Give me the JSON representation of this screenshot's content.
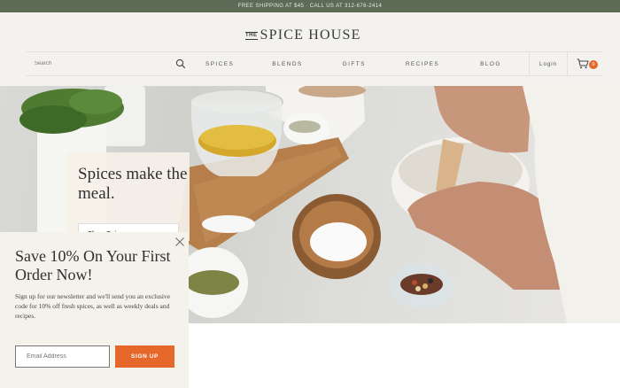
{
  "promo_bar": {
    "text": "FREE SHIPPING AT $45 · CALL US AT 312-676-2414"
  },
  "header": {
    "logo_the": "THE",
    "logo_main": "SPICE HOUSE",
    "search": {
      "placeholder": "Search"
    },
    "nav": [
      {
        "label": "SPICES"
      },
      {
        "label": "BLENDS"
      },
      {
        "label": "GIFTS"
      },
      {
        "label": "RECIPES"
      },
      {
        "label": "BLOG"
      }
    ],
    "login_label": "Login",
    "cart_count": "0"
  },
  "hero": {
    "title": "Spices make the meal.",
    "button_label": "Shop Spices"
  },
  "popup": {
    "title": "Save 10% On Your First Order Now!",
    "text": "Sign up for our newsletter and we'll send you an exclusive code for 10% off fresh spices, as well as weekly deals and recipes.",
    "email_placeholder": "Email Address",
    "signup_label": "SIGN UP"
  },
  "colors": {
    "promo_bar": "#5c6b56",
    "accent": "#e5682a",
    "header_bg": "#f3f2ef",
    "popup_bg": "#f5f2ec"
  }
}
